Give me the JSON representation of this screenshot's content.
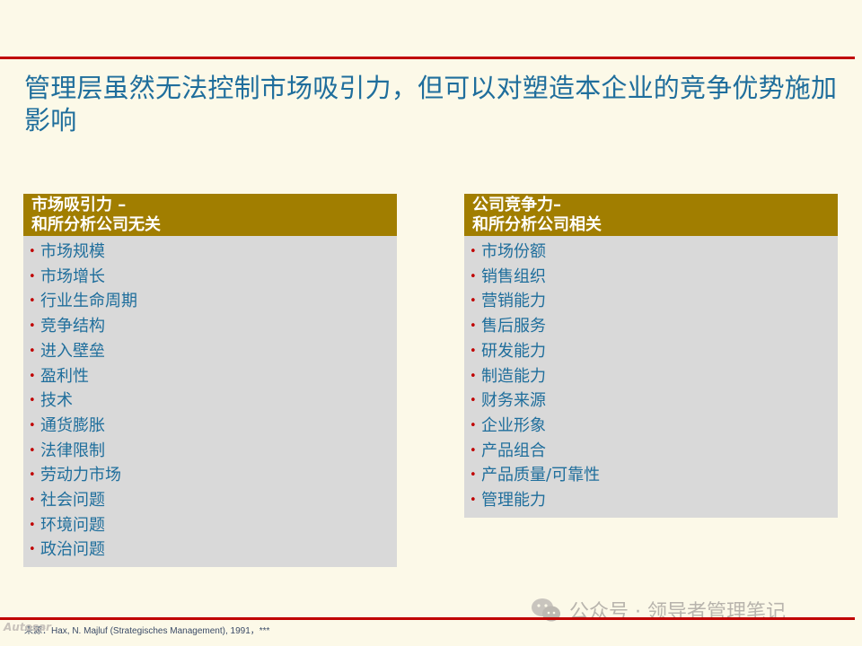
{
  "title": "管理层虽然无法控制市场吸引力，但可以对塑造本企业的竞争优势施加影响",
  "left_panel": {
    "heading_line1": "市场吸引力 –",
    "heading_line2": "和所分析公司无关",
    "items": [
      "市场规模",
      "市场增长",
      "行业生命周期",
      "竞争结构",
      "进入壁垒",
      "盈利性",
      "技术",
      "通货膨胀",
      "法律限制",
      "劳动力市场",
      "社会问题",
      "环境问题",
      "政治问题"
    ]
  },
  "right_panel": {
    "heading_line1": "公司竞争力–",
    "heading_line2": "和所分析公司相关",
    "items": [
      "市场份额",
      "销售组织",
      "营销能力",
      "售后服务",
      "研发能力",
      "制造能力",
      "财务来源",
      "企业形象",
      "产品组合",
      "产品质量/可靠性",
      "管理能力"
    ]
  },
  "footer": {
    "source": "来源：Hax, N. Majluf (Strategisches Management), 1991，***"
  },
  "watermark": {
    "text": "公众号 · 领导者管理笔记",
    "icon": "wechat-icon"
  },
  "corner_logo": {
    "text": "Autosar"
  },
  "colors": {
    "background": "#fcf9e8",
    "rule": "#c00000",
    "title": "#1f6e9c",
    "panel_header": "#a17e00",
    "panel_body": "#d9d9d9",
    "bullet": "#c00000"
  }
}
